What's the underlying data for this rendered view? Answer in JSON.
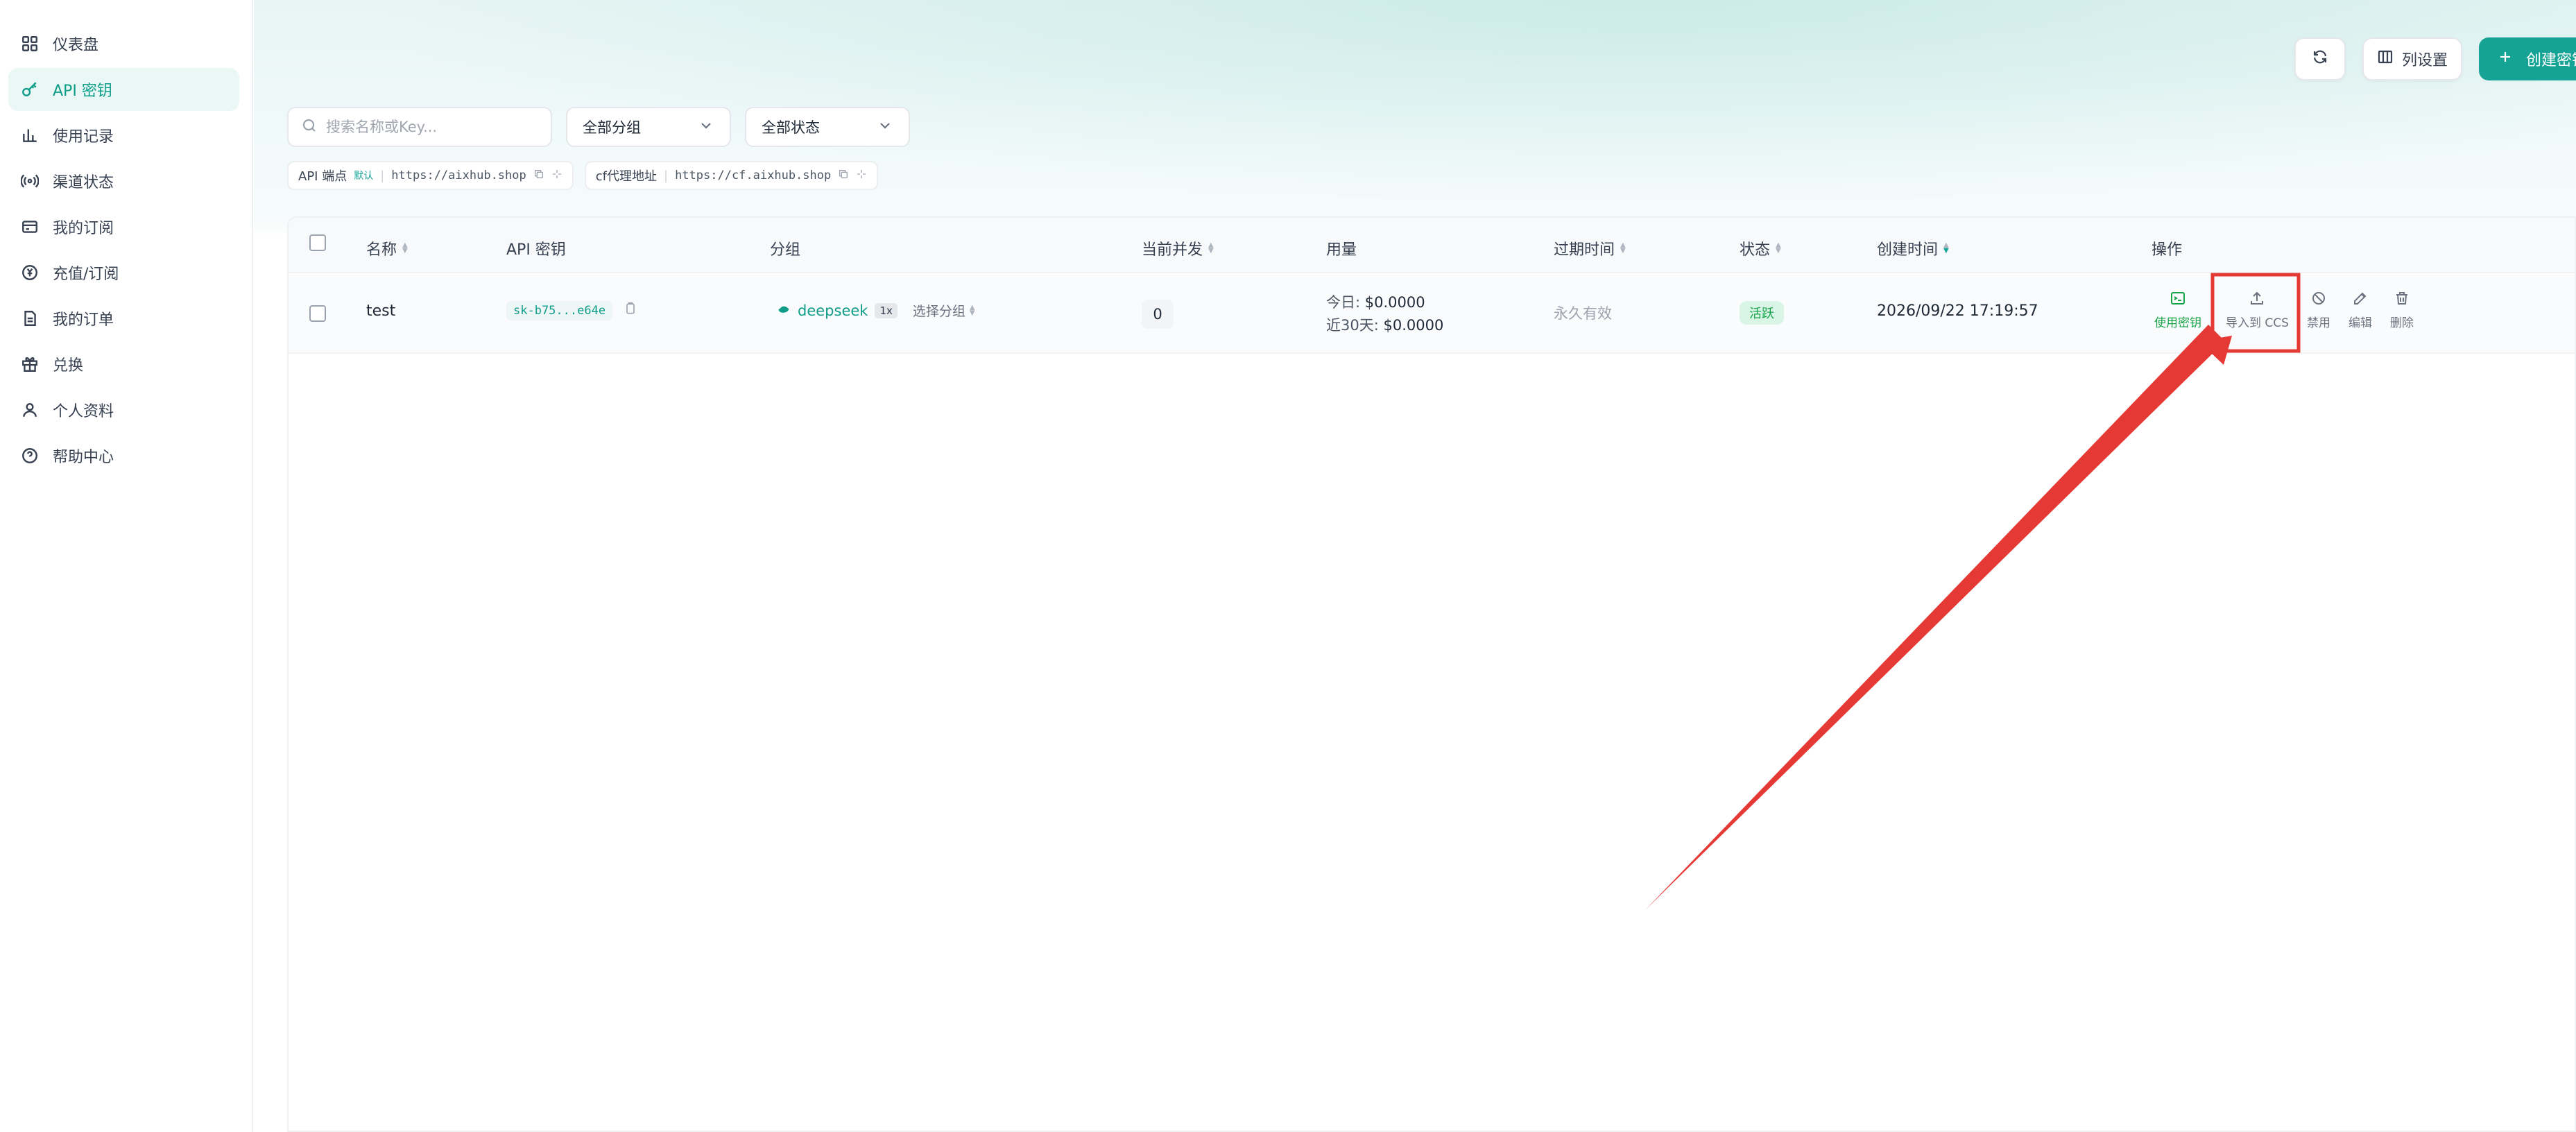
{
  "sidebar": {
    "items": [
      {
        "label": "仪表盘",
        "icon": "dashboard-icon"
      },
      {
        "label": "API 密钥",
        "icon": "key-icon",
        "active": true
      },
      {
        "label": "使用记录",
        "icon": "bar-chart-icon"
      },
      {
        "label": "渠道状态",
        "icon": "signal-icon"
      },
      {
        "label": "我的订阅",
        "icon": "card-icon"
      },
      {
        "label": "充值/订阅",
        "icon": "yen-coin-icon"
      },
      {
        "label": "我的订单",
        "icon": "document-icon"
      },
      {
        "label": "兑换",
        "icon": "gift-icon"
      },
      {
        "label": "个人资料",
        "icon": "user-icon"
      },
      {
        "label": "帮助中心",
        "icon": "help-icon"
      }
    ]
  },
  "toolbar": {
    "refresh_icon": "refresh-icon",
    "column_settings_label": "列设置",
    "create_label": "创建密钥"
  },
  "filters": {
    "search_placeholder": "搜索名称或Key...",
    "group_select": "全部分组",
    "status_select": "全部状态"
  },
  "endpoints": [
    {
      "label": "API 端点",
      "tag": "默认",
      "url": "https://aixhub.shop"
    },
    {
      "label": "cf代理地址",
      "url": "https://cf.aixhub.shop"
    }
  ],
  "table": {
    "headers": {
      "name": "名称",
      "api_key": "API 密钥",
      "group": "分组",
      "concurrency": "当前并发",
      "usage": "用量",
      "expires": "过期时间",
      "status": "状态",
      "created": "创建时间",
      "actions": "操作"
    },
    "rows": [
      {
        "name": "test",
        "api_key": "sk-b75...e64e",
        "group": "deepseek",
        "multiplier": "1x",
        "select_group": "选择分组",
        "concurrency": "0",
        "usage_today_label": "今日:",
        "usage_today": "$0.0000",
        "usage_30d_label": "近30天:",
        "usage_30d": "$0.0000",
        "expires": "永久有效",
        "status": "活跃",
        "created": "2026/09/22 17:19:57",
        "actions": {
          "use_key": "使用密钥",
          "import_ccs": "导入到 CCS",
          "disable": "禁用",
          "edit": "编辑",
          "delete": "删除"
        }
      }
    ]
  },
  "colors": {
    "accent": "#14a394",
    "status_green": "#16a34a",
    "annotation_red": "#e53935"
  }
}
